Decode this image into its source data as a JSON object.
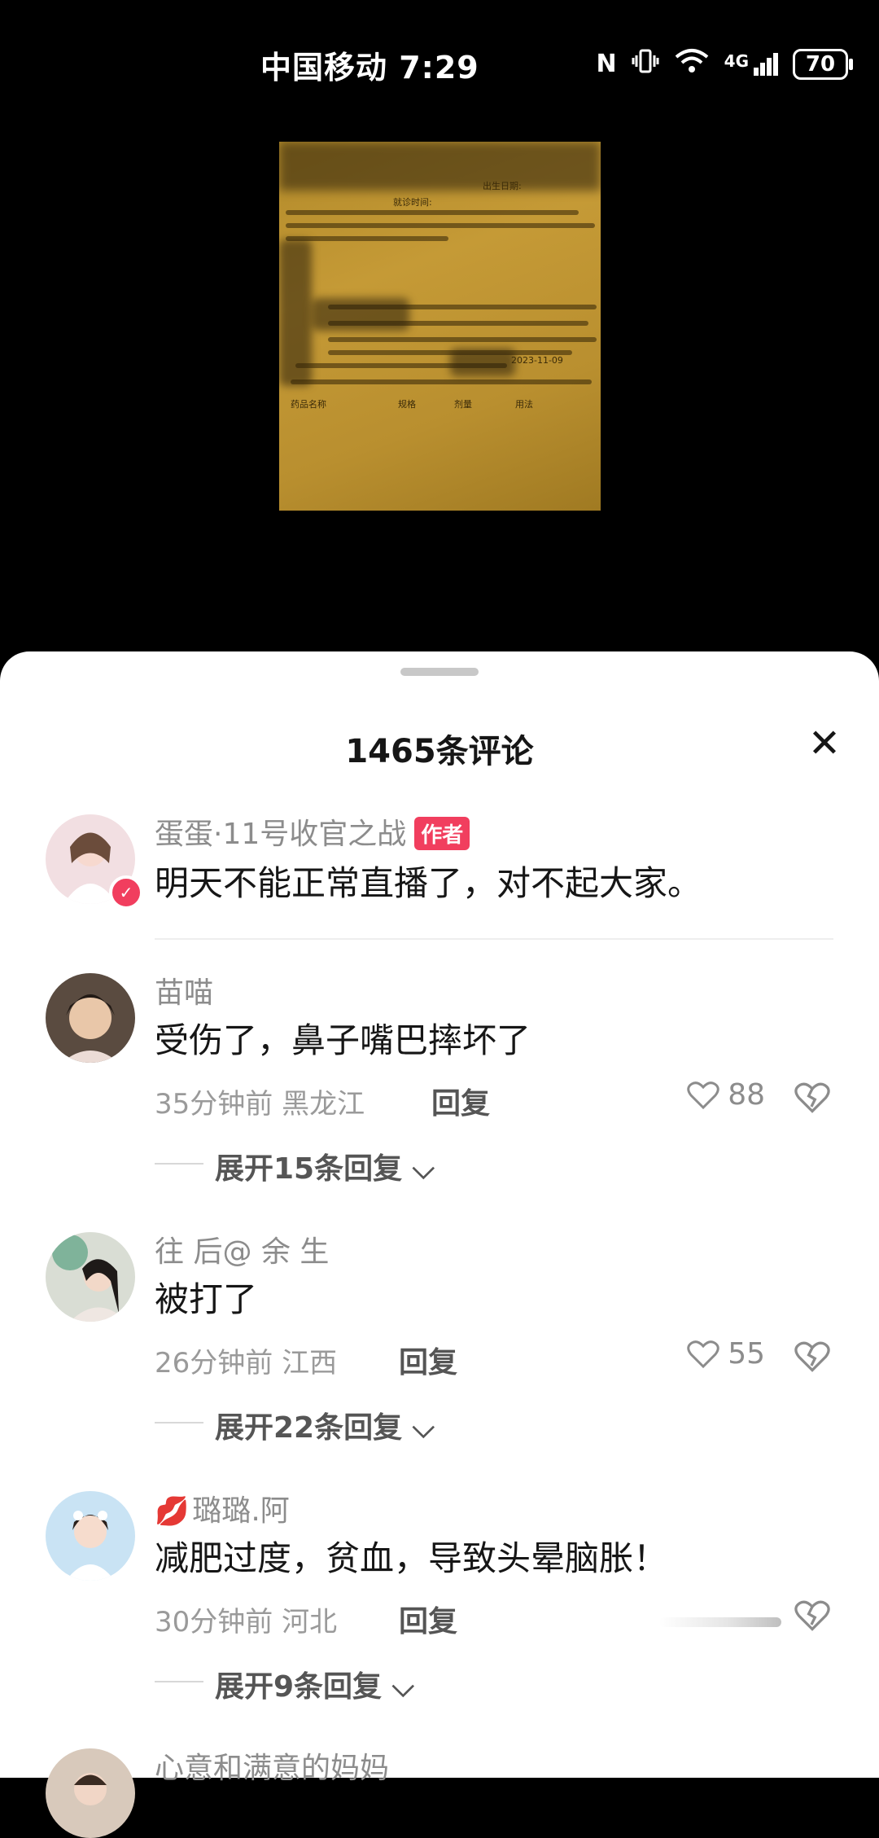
{
  "status_bar": {
    "carrier_time": "中国移动 7:29",
    "nfc": "N",
    "network": "4G",
    "battery": "70"
  },
  "photo": {
    "visible_lines": [
      "出生日期:",
      "就诊时间:",
      "2023-11-09",
      "规格",
      "剂量",
      "用法",
      "药品名称"
    ]
  },
  "sheet": {
    "title": "1465条评论",
    "close_icon": "close-icon"
  },
  "comments": [
    {
      "username": "蛋蛋·11号收官之战",
      "badge": "作者",
      "text": "明天不能正常直播了，对不起大家。",
      "avatar_color": "#e9c9cf"
    },
    {
      "username": "苗喵",
      "text": "受伤了，鼻子嘴巴摔坏了",
      "time": "35分钟前",
      "location": "黑龙江",
      "reply": "回复",
      "likes": "88",
      "expand": "展开15条回复",
      "avatar_color": "#3b2a22"
    },
    {
      "username": "往 后@ 余 生",
      "text": "被打了",
      "time": "26分钟前",
      "location": "江西",
      "reply": "回复",
      "likes": "55",
      "expand": "展开22条回复",
      "avatar_color": "#b9c7b4"
    },
    {
      "username": "璐璐.阿",
      "text": "减肥过度，贫血，导致头晕脑胀！",
      "time": "30分钟前",
      "location": "河北",
      "reply": "回复",
      "expand": "展开9条回复",
      "avatar_color": "#b7d6ee"
    },
    {
      "username": "心意和满意的妈妈",
      "avatar_color": "#c9b6a4"
    }
  ],
  "colors": {
    "accent": "#f13e5e",
    "text_primary": "#161616",
    "text_secondary": "#8c8c8c"
  }
}
